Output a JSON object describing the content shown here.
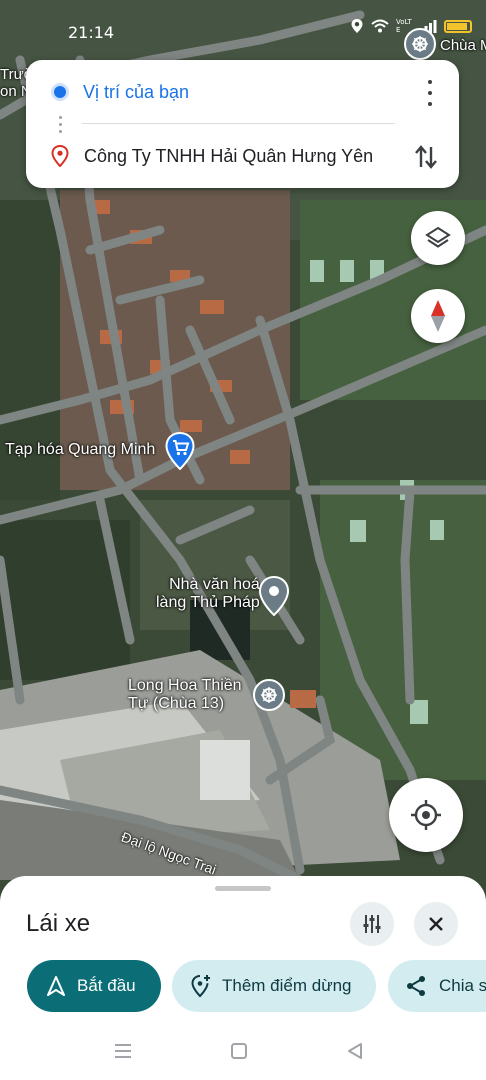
{
  "status_bar": {
    "time": "21:14",
    "network_badge": "VoLTE"
  },
  "route": {
    "origin": "Vị trí của bạn",
    "destination": "Công Ty TNHH Hải Quân Hưng Yên"
  },
  "map": {
    "labels": {
      "top_left_1": "Trườ",
      "top_left_2": "on N",
      "top_right_poi": "Chùa M",
      "store": "Tạp hóa Quang Minh",
      "culture_house_1": "Nhà văn hoá",
      "culture_house_2": "làng Thủ Pháp",
      "temple_1": "Long Hoa Thiền",
      "temple_2": "Tự (Chùa 13)",
      "road": "Đại lộ Ngọc Trai"
    },
    "colors": {
      "road": "#7f8583",
      "terrain": "#3b4a36",
      "pin_blue": "#1a73e8",
      "pin_gray": "#6b7c86"
    }
  },
  "sheet": {
    "title": "Lái xe",
    "start_button": "Bắt đầu",
    "add_stop_button": "Thêm điểm dừng",
    "share_button": "Chia s"
  },
  "icons": {
    "accent": "#0b6e76",
    "chip_bg": "#d3ecf0",
    "dest_pin": "#d93025"
  }
}
